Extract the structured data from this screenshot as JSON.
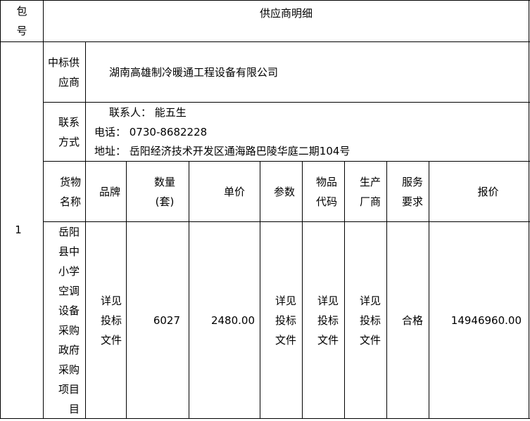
{
  "header": {
    "package_no_label": "包号",
    "supplier_detail_label": "供应商明细"
  },
  "row": {
    "package_no": "1",
    "winning_supplier_label": "中标供应商",
    "winning_supplier": "湖南高雄制冷暖通工程设备有限公司",
    "contact_label": "联系方式",
    "contact_person": "联系人： 能五生",
    "phone": "电话： 0730-8682228",
    "address": "地址： 岳阳经济技术开发区通海路巴陵华庭二期104号"
  },
  "columns": {
    "goods_name": "货物名称",
    "brand": "品牌",
    "quantity": "数量(套)",
    "unit_price": "单价",
    "parameters": "参数",
    "item_code": "物品代码",
    "manufacturer": "生产厂商",
    "service_req": "服务要求",
    "quote": "报价"
  },
  "item": {
    "goods_name": "岳阳县中小学空调设备采购政府采购项目目",
    "brand": "详见投标文件",
    "quantity": "6027",
    "unit_price": "2480.00",
    "parameters": "详见投标文件",
    "item_code": "详见投标文件",
    "manufacturer": "详见投标文件",
    "service_req": "合格",
    "quote": "14946960.00"
  }
}
